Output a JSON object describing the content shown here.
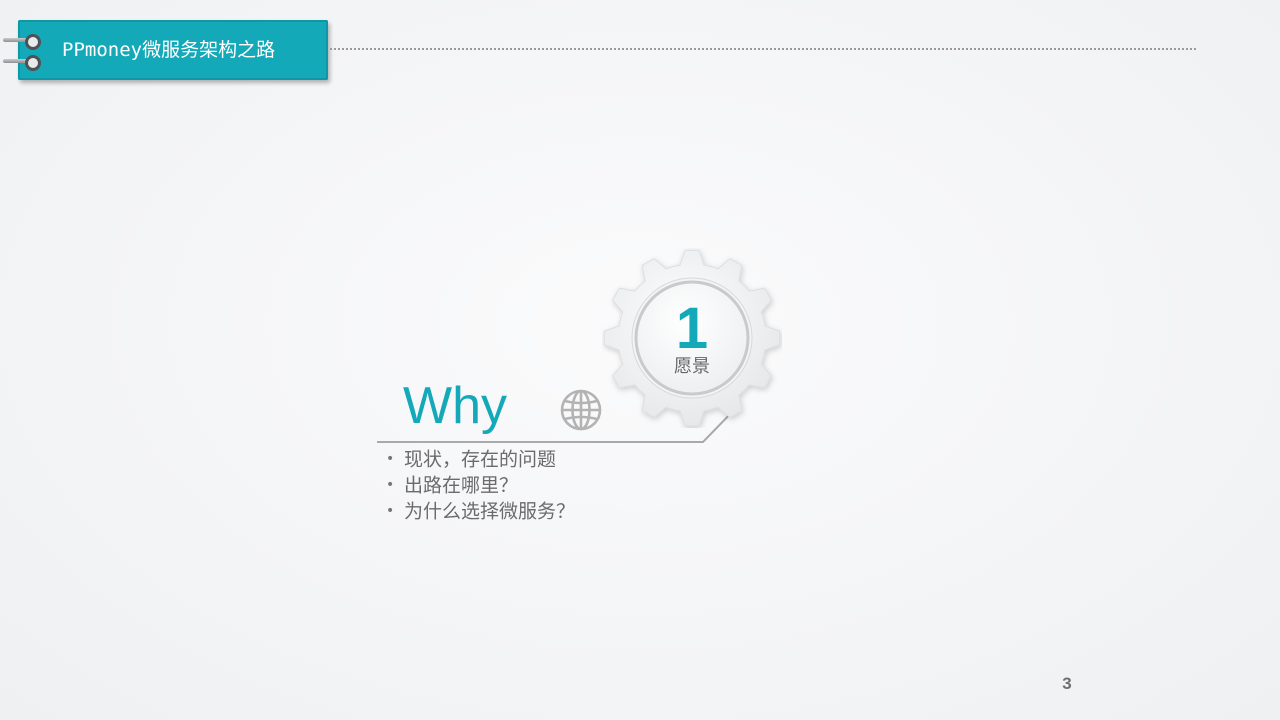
{
  "header": {
    "title": "PPmoney微服务架构之路",
    "accent_color": "#14a9b8"
  },
  "section": {
    "number": "1",
    "label": "愿景",
    "heading": "Why",
    "icon": "globe-icon",
    "bullets": [
      "现状，存在的问题",
      "出路在哪里？",
      "为什么选择微服务？"
    ]
  },
  "footer": {
    "page_number": "3"
  }
}
